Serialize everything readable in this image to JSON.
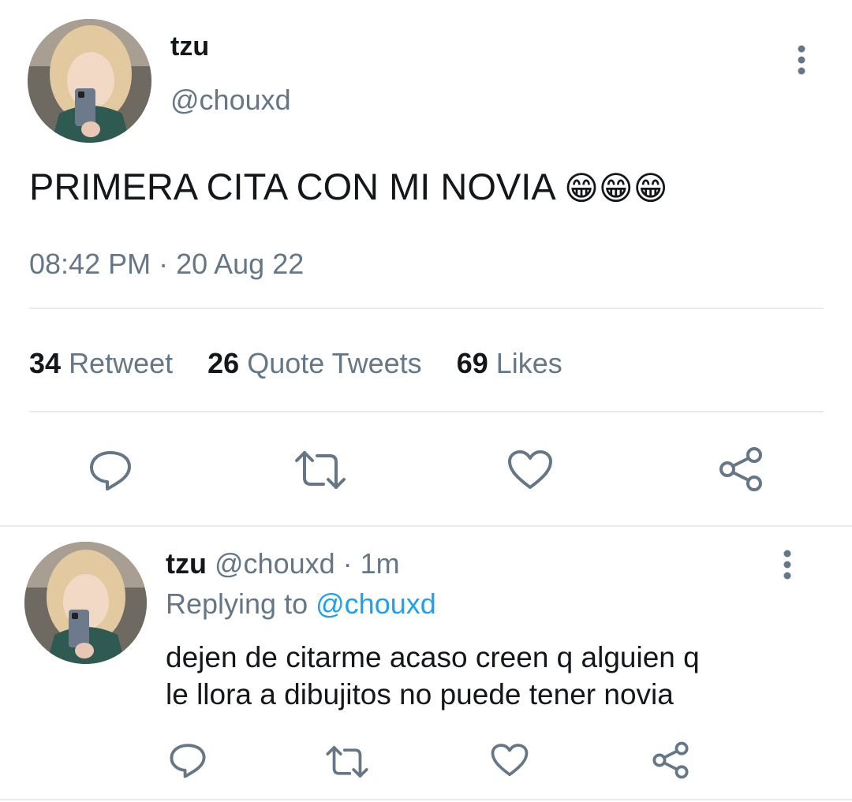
{
  "tweet": {
    "display_name": "tzu",
    "handle": "@chouxd",
    "text": "PRIMERA CITA CON MI NOVIA",
    "emoji": "😁😁😁",
    "timestamp": "08:42 PM · 20 Aug 22",
    "stats": {
      "retweets_count": "34",
      "retweets_label": "Retweet",
      "quotes_count": "26",
      "quotes_label": "Quote Tweets",
      "likes_count": "69",
      "likes_label": "Likes"
    },
    "actions": [
      "reply-icon",
      "retweet-icon",
      "like-icon",
      "share-icon"
    ]
  },
  "reply": {
    "display_name": "tzu",
    "handle_time": "@chouxd · 1m",
    "replying_prefix": "Replying to",
    "replying_to": "@chouxd",
    "text_line1": "dejen de citarme acaso creen q alguien q",
    "text_line2": "le llora a dibujitos no puede tener novia",
    "actions": [
      "reply-icon",
      "retweet-icon",
      "like-icon",
      "share-icon"
    ]
  },
  "colors": {
    "text": "#14171a",
    "muted": "#657786",
    "link": "#1da1f2",
    "separator": "#e6ecf0"
  }
}
